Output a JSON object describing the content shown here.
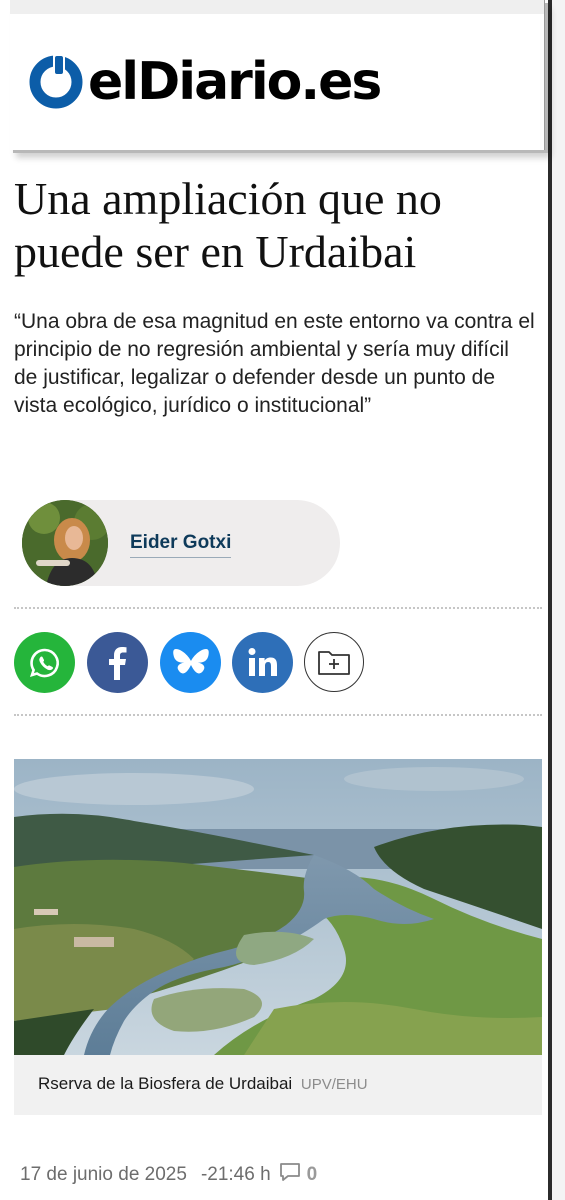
{
  "header": {
    "brand": "elDiario.es"
  },
  "article": {
    "headline": "Una ampliación que no puede ser en Urdaibai",
    "lead": "“Una obra de esa magnitud en este entorno va contra el principio de no regresión ambiental y sería muy difícil de justificar, legalizar o defender desde un punto de vista ecológico, jurídico o institucional”",
    "author": "Eider Gotxi",
    "image_caption": "Rserva de la Biosfera de Urdaibai",
    "image_credit": "UPV/EHU",
    "date": "17 de junio de 2025",
    "time": "-21:46 h",
    "comments": "0"
  },
  "share": [
    {
      "name": "whatsapp",
      "icon": "whatsapp-icon",
      "color": "#25b53b"
    },
    {
      "name": "facebook",
      "icon": "facebook-icon",
      "color": "#3b5996"
    },
    {
      "name": "bluesky",
      "icon": "bluesky-icon",
      "color": "#1a8cf0"
    },
    {
      "name": "linkedin",
      "icon": "linkedin-icon",
      "color": "#2e6fb8"
    },
    {
      "name": "save",
      "icon": "folder-add-icon",
      "color": "#ffffff"
    }
  ],
  "colors": {
    "brand_blue": "#0c5da8",
    "author_name": "#0e3a5a"
  }
}
